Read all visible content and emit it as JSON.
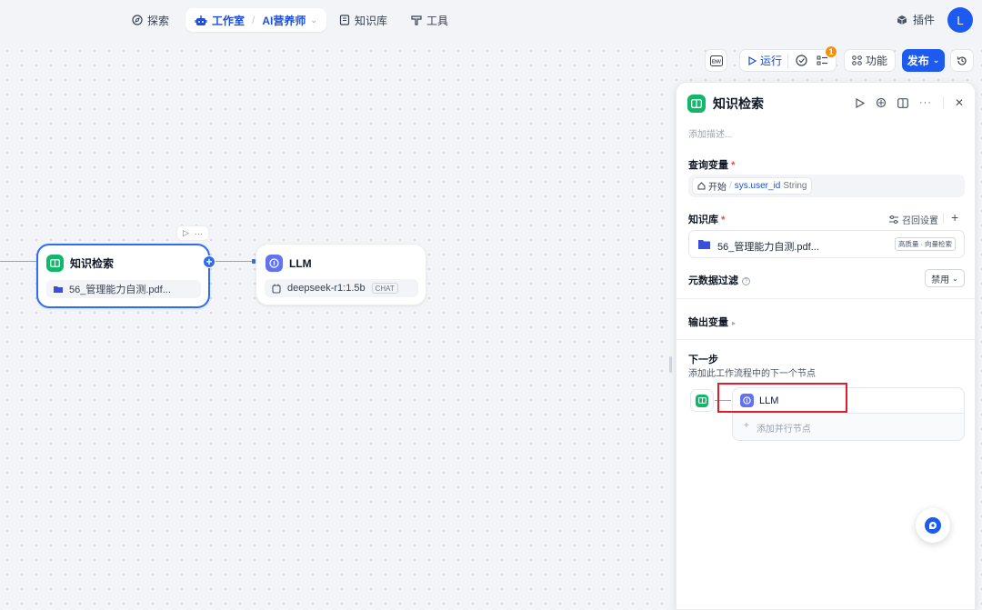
{
  "nav": {
    "explore": "探索",
    "studio": "工作室",
    "app_name": "AI营养师",
    "knowledge": "知识库",
    "tools": "工具",
    "plugins": "插件",
    "avatar_letter": "L"
  },
  "toolbar": {
    "env": "ENV",
    "run": "运行",
    "badge_count": "1",
    "features": "功能",
    "publish": "发布"
  },
  "canvas": {
    "kr_node": {
      "title": "知识检索",
      "kb_file": "56_管理能力自测.pdf..."
    },
    "llm_node": {
      "title": "LLM",
      "model": "deepseek-r1:1.5b",
      "model_tag": "CHAT"
    }
  },
  "panel": {
    "title": "知识检索",
    "desc_placeholder": "添加描述...",
    "query_var_label": "查询变量",
    "query_var": {
      "source": "开始",
      "name": "sys.user_id",
      "type": "String"
    },
    "kb_label": "知识库",
    "recall_settings": "召回设置",
    "kb_item": {
      "name": "56_管理能力自测.pdf...",
      "tag_a": "高质量",
      "tag_sep": "·",
      "tag_b": "向量检索"
    },
    "meta_filter_label": "元数据过滤",
    "meta_filter_value": "禁用",
    "output_vars_label": "输出变量",
    "next_step_label": "下一步",
    "next_step_desc": "添加此工作流程中的下一个节点",
    "next_node": "LLM",
    "add_parallel": "添加并行节点"
  },
  "colors": {
    "accent": "#1d5bf0",
    "green": "#12b76a",
    "indigo": "#6172f3",
    "highlight": "#e11d2a",
    "badge": "#f79009"
  }
}
